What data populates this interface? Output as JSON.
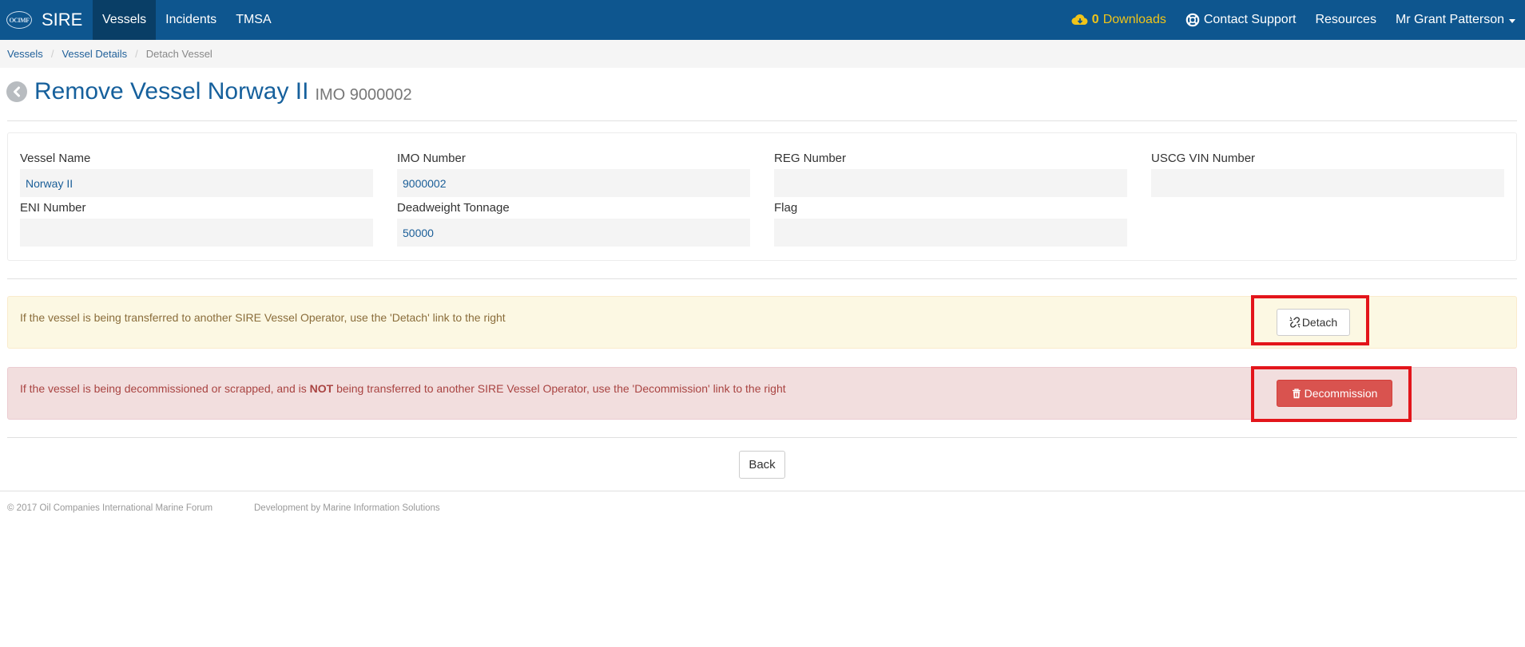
{
  "navbar": {
    "logo_text": "OCIMF",
    "brand": "SIRE",
    "items": [
      {
        "label": "Vessels",
        "active": true
      },
      {
        "label": "Incidents",
        "active": false
      },
      {
        "label": "TMSA",
        "active": false
      }
    ],
    "downloads": {
      "count": "0",
      "label": "Downloads",
      "icon": "cloud-download-icon"
    },
    "support": {
      "label": "Contact Support",
      "icon": "life-ring-icon"
    },
    "resources": "Resources",
    "user": "Mr Grant Patterson"
  },
  "breadcrumb": {
    "items": [
      "Vessels",
      "Vessel Details"
    ],
    "current": "Detach Vessel"
  },
  "page": {
    "title": "Remove Vessel Norway II",
    "subtitle": "IMO 9000002"
  },
  "vessel": {
    "name": {
      "label": "Vessel Name",
      "value": "Norway II"
    },
    "imo": {
      "label": "IMO Number",
      "value": "9000002"
    },
    "reg": {
      "label": "REG Number",
      "value": ""
    },
    "uscg": {
      "label": "USCG VIN Number",
      "value": ""
    },
    "eni": {
      "label": "ENI Number",
      "value": ""
    },
    "dwt": {
      "label": "Deadweight Tonnage",
      "value": "50000"
    },
    "flag": {
      "label": "Flag",
      "value": ""
    }
  },
  "alerts": {
    "detach": {
      "text": "If the vessel is being transferred to another SIRE Vessel Operator, use the 'Detach' link to the right",
      "button": "Detach"
    },
    "decommission": {
      "text_before": "If the vessel is being decommissioned or scrapped, and is ",
      "text_strong": "NOT",
      "text_after": " being transferred to another SIRE Vessel Operator, use the 'Decommission' link to the right",
      "button": "Decommission"
    }
  },
  "back_button": "Back",
  "footer": {
    "copyright": "© 2017 Oil Companies International Marine Forum",
    "developer": "Development by Marine Information Solutions"
  },
  "colors": {
    "navbar": "#0e568f",
    "highlight": "#e3151b",
    "danger": "#d9534f"
  }
}
